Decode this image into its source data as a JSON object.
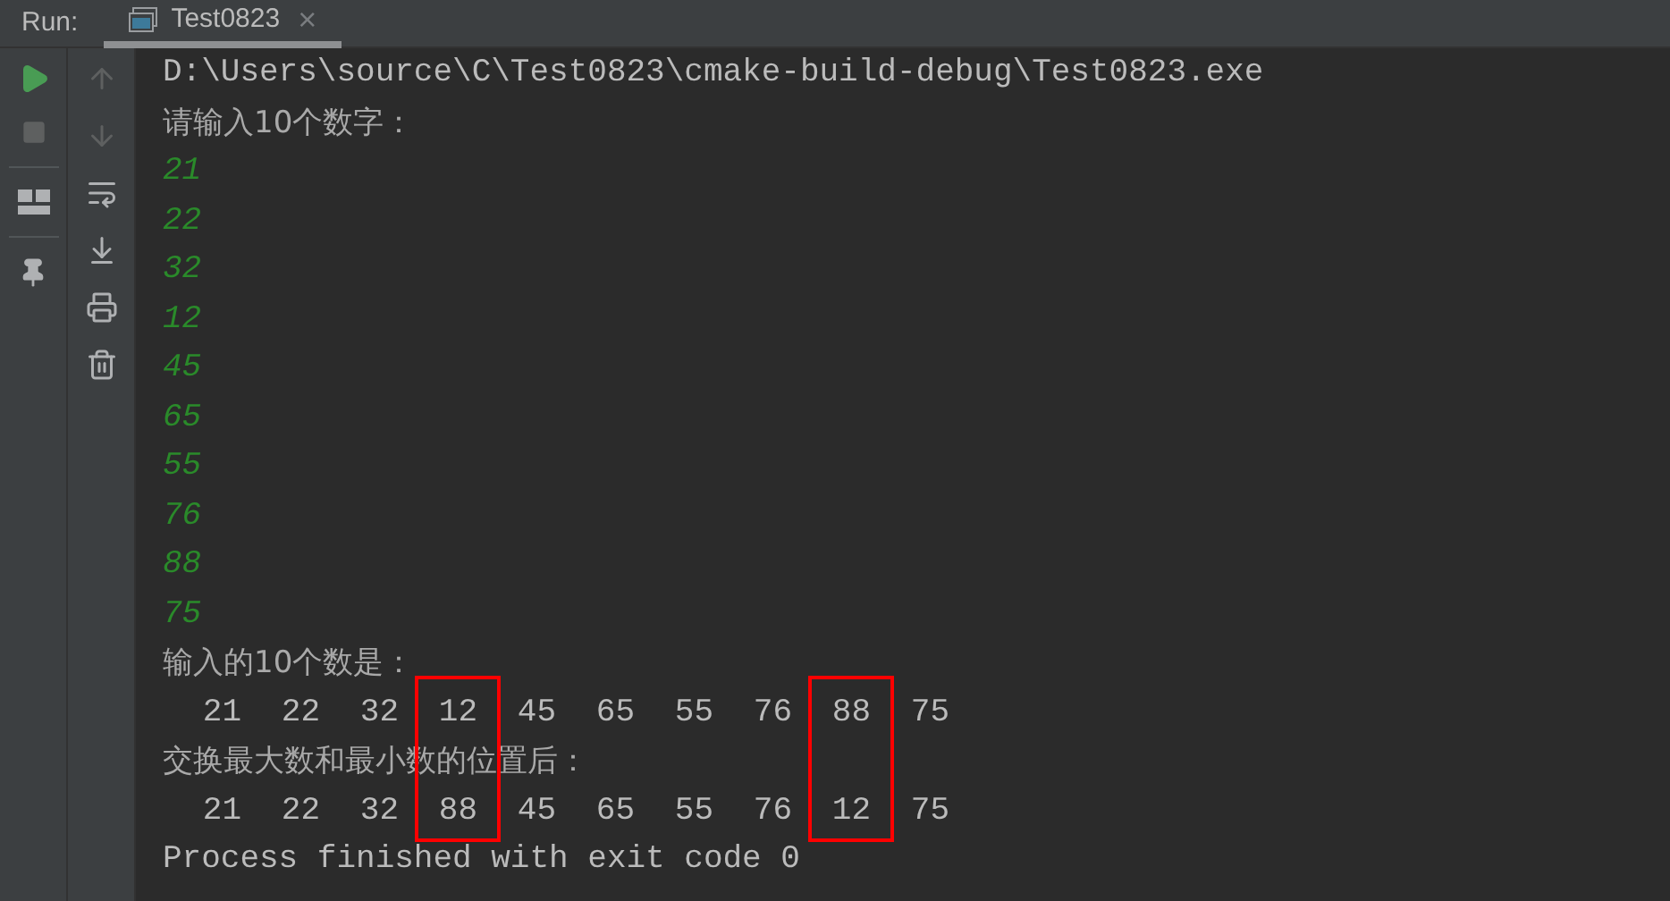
{
  "run_bar": {
    "label": "Run:",
    "tabs": [
      {
        "title": "Test0823",
        "close": "×",
        "selected": true
      }
    ]
  },
  "console": {
    "lines": [
      {
        "kind": "system",
        "text": "D:\\Users\\source\\C\\Test0823\\cmake-build-debug\\Test0823.exe"
      },
      {
        "kind": "message",
        "text": "请输入10个数字："
      },
      {
        "kind": "input",
        "text": "21"
      },
      {
        "kind": "input",
        "text": "22"
      },
      {
        "kind": "input",
        "text": "32"
      },
      {
        "kind": "input",
        "text": "12"
      },
      {
        "kind": "input",
        "text": "45"
      },
      {
        "kind": "input",
        "text": "65"
      },
      {
        "kind": "input",
        "text": "55"
      },
      {
        "kind": "input",
        "text": "76"
      },
      {
        "kind": "input",
        "text": "88"
      },
      {
        "kind": "input",
        "text": "75"
      },
      {
        "kind": "message",
        "text": "输入的10个数是："
      },
      {
        "kind": "numbers",
        "cells": [
          {
            "text": "21",
            "boxed": false
          },
          {
            "text": "22",
            "boxed": false
          },
          {
            "text": "32",
            "boxed": false
          },
          {
            "text": "12",
            "boxed": true
          },
          {
            "text": "45",
            "boxed": false
          },
          {
            "text": "65",
            "boxed": false
          },
          {
            "text": "55",
            "boxed": false
          },
          {
            "text": "76",
            "boxed": false
          },
          {
            "text": "88",
            "boxed": true
          },
          {
            "text": "75",
            "boxed": false
          }
        ]
      },
      {
        "kind": "message",
        "text": "交换最大数和最小数的位置后："
      },
      {
        "kind": "numbers",
        "cells": [
          {
            "text": "21",
            "boxed": false
          },
          {
            "text": "22",
            "boxed": false
          },
          {
            "text": "32",
            "boxed": false
          },
          {
            "text": "88",
            "boxed": true
          },
          {
            "text": "45",
            "boxed": false
          },
          {
            "text": "65",
            "boxed": false
          },
          {
            "text": "55",
            "boxed": false
          },
          {
            "text": "76",
            "boxed": false
          },
          {
            "text": "12",
            "boxed": true
          },
          {
            "text": "75",
            "boxed": false
          }
        ]
      },
      {
        "kind": "system",
        "text": "Process finished with exit code 0"
      }
    ]
  }
}
